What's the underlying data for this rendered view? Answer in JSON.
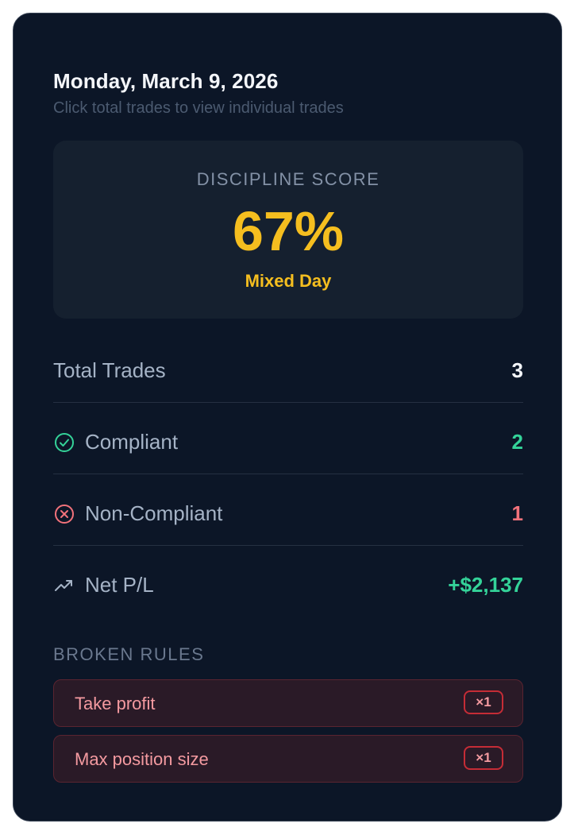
{
  "header": {
    "date": "Monday, March 9, 2026",
    "hint": "Click total trades to view individual trades"
  },
  "discipline": {
    "label": "DISCIPLINE SCORE",
    "score": "67%",
    "status": "Mixed Day",
    "color": "#f5be1f"
  },
  "stats": {
    "total_trades": {
      "label": "Total Trades",
      "value": "3",
      "color": "#f4f6fa"
    },
    "compliant": {
      "label": "Compliant",
      "value": "2",
      "icon": "check-circle-icon",
      "color": "#34d399"
    },
    "non_compliant": {
      "label": "Non-Compliant",
      "value": "1",
      "icon": "x-circle-icon",
      "color": "#f2727b"
    },
    "net_pl": {
      "label": "Net P/L",
      "value": "+$2,137",
      "icon": "trending-up-icon",
      "color": "#34d399"
    }
  },
  "broken_rules": {
    "label": "BROKEN RULES",
    "items": [
      {
        "name": "Take profit",
        "count": "×1"
      },
      {
        "name": "Max position size",
        "count": "×1"
      }
    ]
  }
}
